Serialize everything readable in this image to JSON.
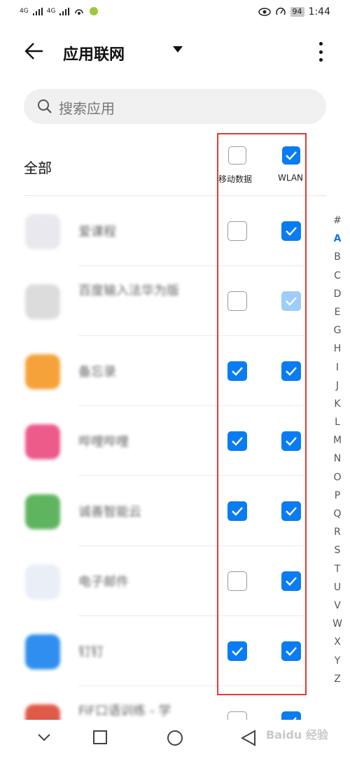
{
  "status_bar": {
    "signal1": "4G",
    "signal2": "4G",
    "battery": "94",
    "time": "1:44"
  },
  "app_bar": {
    "title": "应用联网"
  },
  "search": {
    "placeholder": "搜索应用"
  },
  "header": {
    "all_label": "全部",
    "mobile_label": "移动数据",
    "wlan_label": "WLAN",
    "mobile_all": false,
    "wlan_all": true
  },
  "apps": [
    {
      "name": "爱课程",
      "mobile": "off",
      "wlan": "on",
      "icon": "aikecheng-icon",
      "color": "#e8e8ee"
    },
    {
      "name": "百度输入法华为版",
      "mobile": "off",
      "wlan": "dim",
      "icon": "baidu-input-icon",
      "color": "#dcdcdc"
    },
    {
      "name": "备忘录",
      "mobile": "on",
      "wlan": "on",
      "icon": "notes-icon",
      "color": "#f6a23a"
    },
    {
      "name": "哔哩哔哩",
      "mobile": "on",
      "wlan": "on",
      "icon": "bilibili-icon",
      "color": "#ec5b8a"
    },
    {
      "name": "诚善智能云",
      "mobile": "on",
      "wlan": "on",
      "icon": "cloud-app-icon",
      "color": "#5fb55f"
    },
    {
      "name": "电子邮件",
      "mobile": "off",
      "wlan": "on",
      "icon": "email-icon",
      "color": "#eaeef6"
    },
    {
      "name": "钉钉",
      "mobile": "on",
      "wlan": "on",
      "icon": "dingtalk-icon",
      "color": "#2f8ef0"
    },
    {
      "name": "FiF口语训练 - 学",
      "mobile": "off",
      "wlan": "on",
      "icon": "fif-icon",
      "color": "#e05a4a"
    }
  ],
  "alphabet": [
    "#",
    "A",
    "B",
    "C",
    "D",
    "E",
    "G",
    "H",
    "I",
    "J",
    "K",
    "L",
    "M",
    "N",
    "O",
    "P",
    "Q",
    "R",
    "S",
    "T",
    "U",
    "V",
    "W",
    "X",
    "Y",
    "Z"
  ],
  "alphabet_active": "A",
  "watermark": "Baidu 经验",
  "colors": {
    "accent": "#0a7cf3",
    "highlight_box": "#e53935"
  }
}
